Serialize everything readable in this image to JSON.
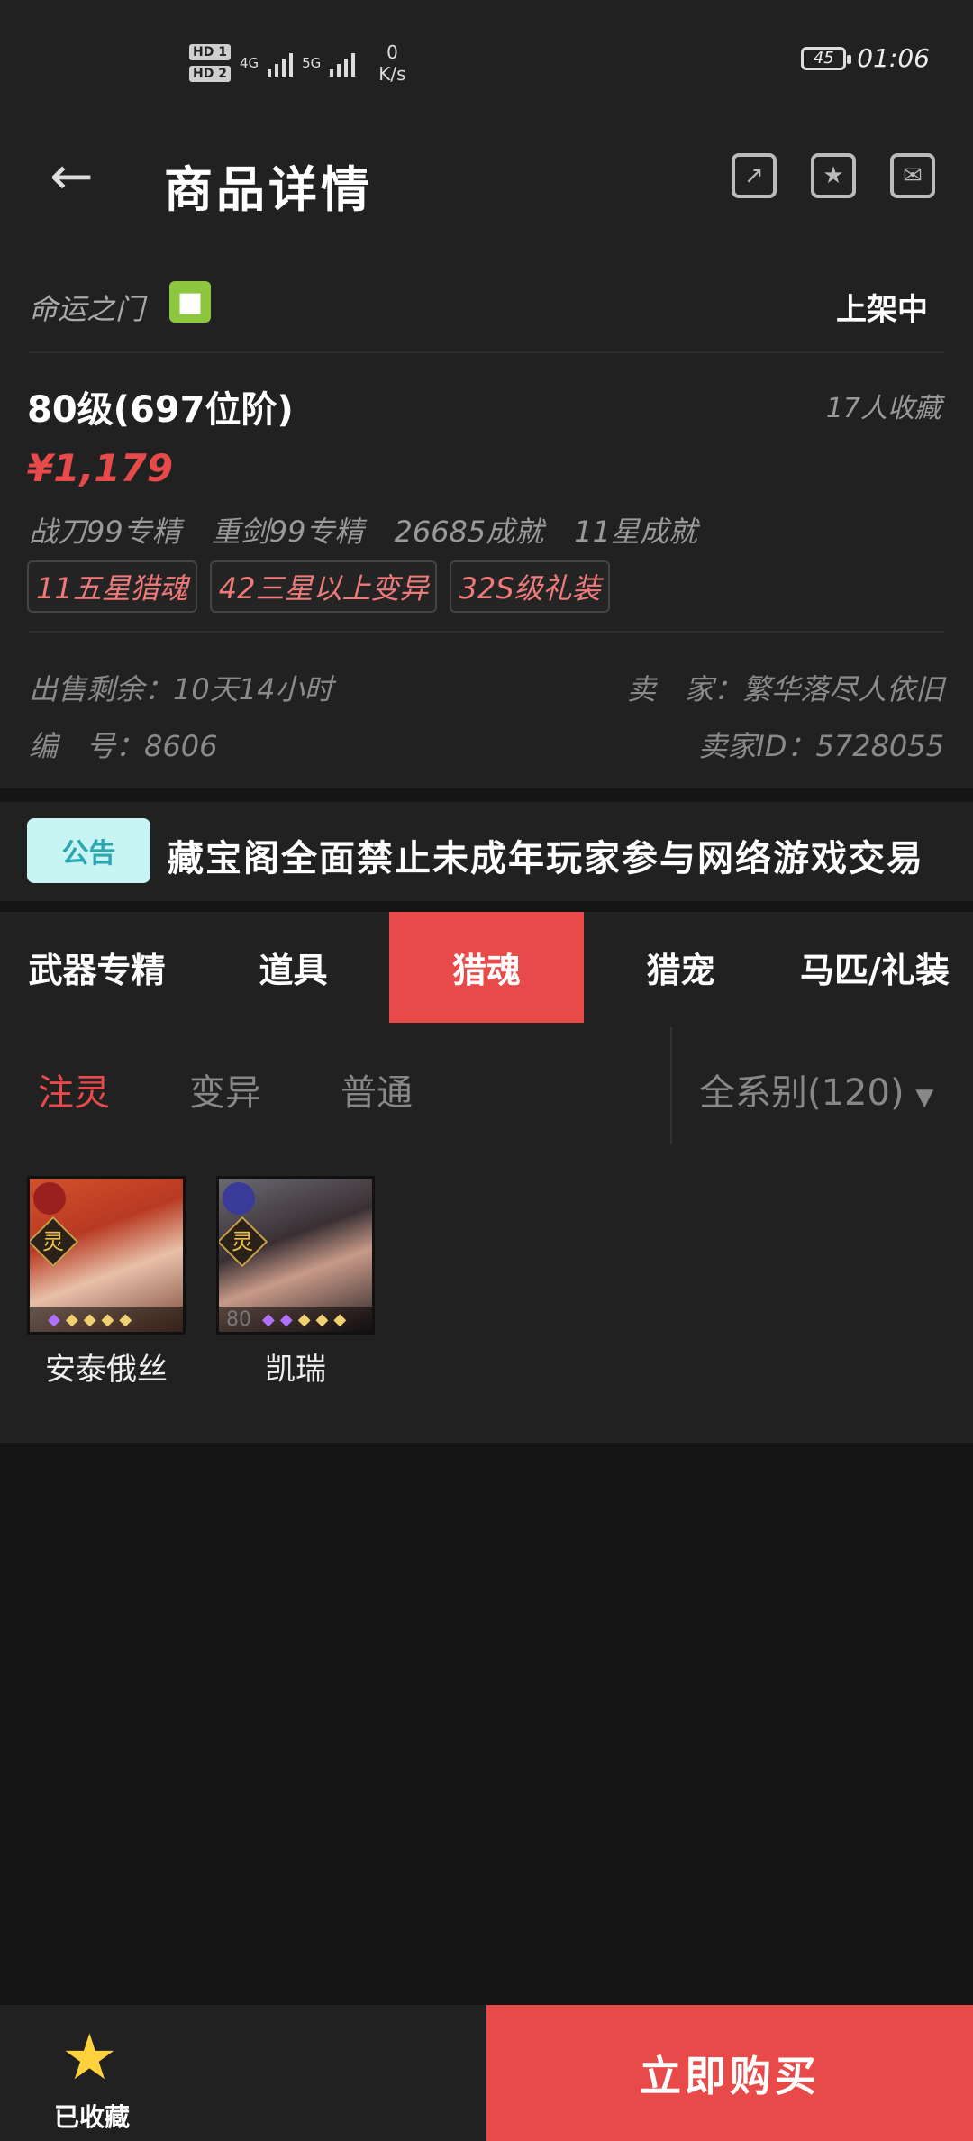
{
  "status_bar": {
    "hd1": "HD 1",
    "hd2": "HD 2",
    "net1": "4G",
    "net2": "5G",
    "speed_value": "0",
    "speed_unit": "K/s",
    "battery": "45",
    "time": "01:06"
  },
  "nav": {
    "title": "商品详情"
  },
  "info": {
    "game": "命运之门",
    "listing_status": "上架中",
    "level": "80级(697位阶)",
    "favorites": "17人收藏",
    "price": "¥1,179",
    "stats": [
      "战刀99专精",
      "重剑99专精",
      "26685成就",
      "11星成就"
    ],
    "tags": [
      "11五星猎魂",
      "42三星以上变异",
      "32S级礼装"
    ],
    "sale_remaining_label": "出售剩余：",
    "sale_remaining_value": "10天14小时",
    "seller_label": "卖　家：",
    "seller_value": "繁华落尽人依旧",
    "serial_label": "编　号：",
    "serial_value": "8606",
    "seller_id_label": "卖家ID：",
    "seller_id_value": "5728055"
  },
  "notice": {
    "badge": "公告",
    "text": "藏宝阁全面禁止未成年玩家参与网络游戏交易"
  },
  "tabs": [
    "武器专精",
    "道具",
    "猎魂",
    "猎宠",
    "马匹/礼装"
  ],
  "active_tab": "猎魂",
  "filters": {
    "options": [
      "注灵",
      "变异",
      "普通"
    ],
    "active": "注灵",
    "dropdown": "全系别(120)"
  },
  "items": [
    {
      "name": "安泰俄丝",
      "badge": "灵",
      "level": ""
    },
    {
      "name": "凯瑞",
      "badge": "灵",
      "level": "80"
    }
  ],
  "bottom": {
    "favorite_label": "已收藏",
    "buy_label": "立即购买"
  }
}
